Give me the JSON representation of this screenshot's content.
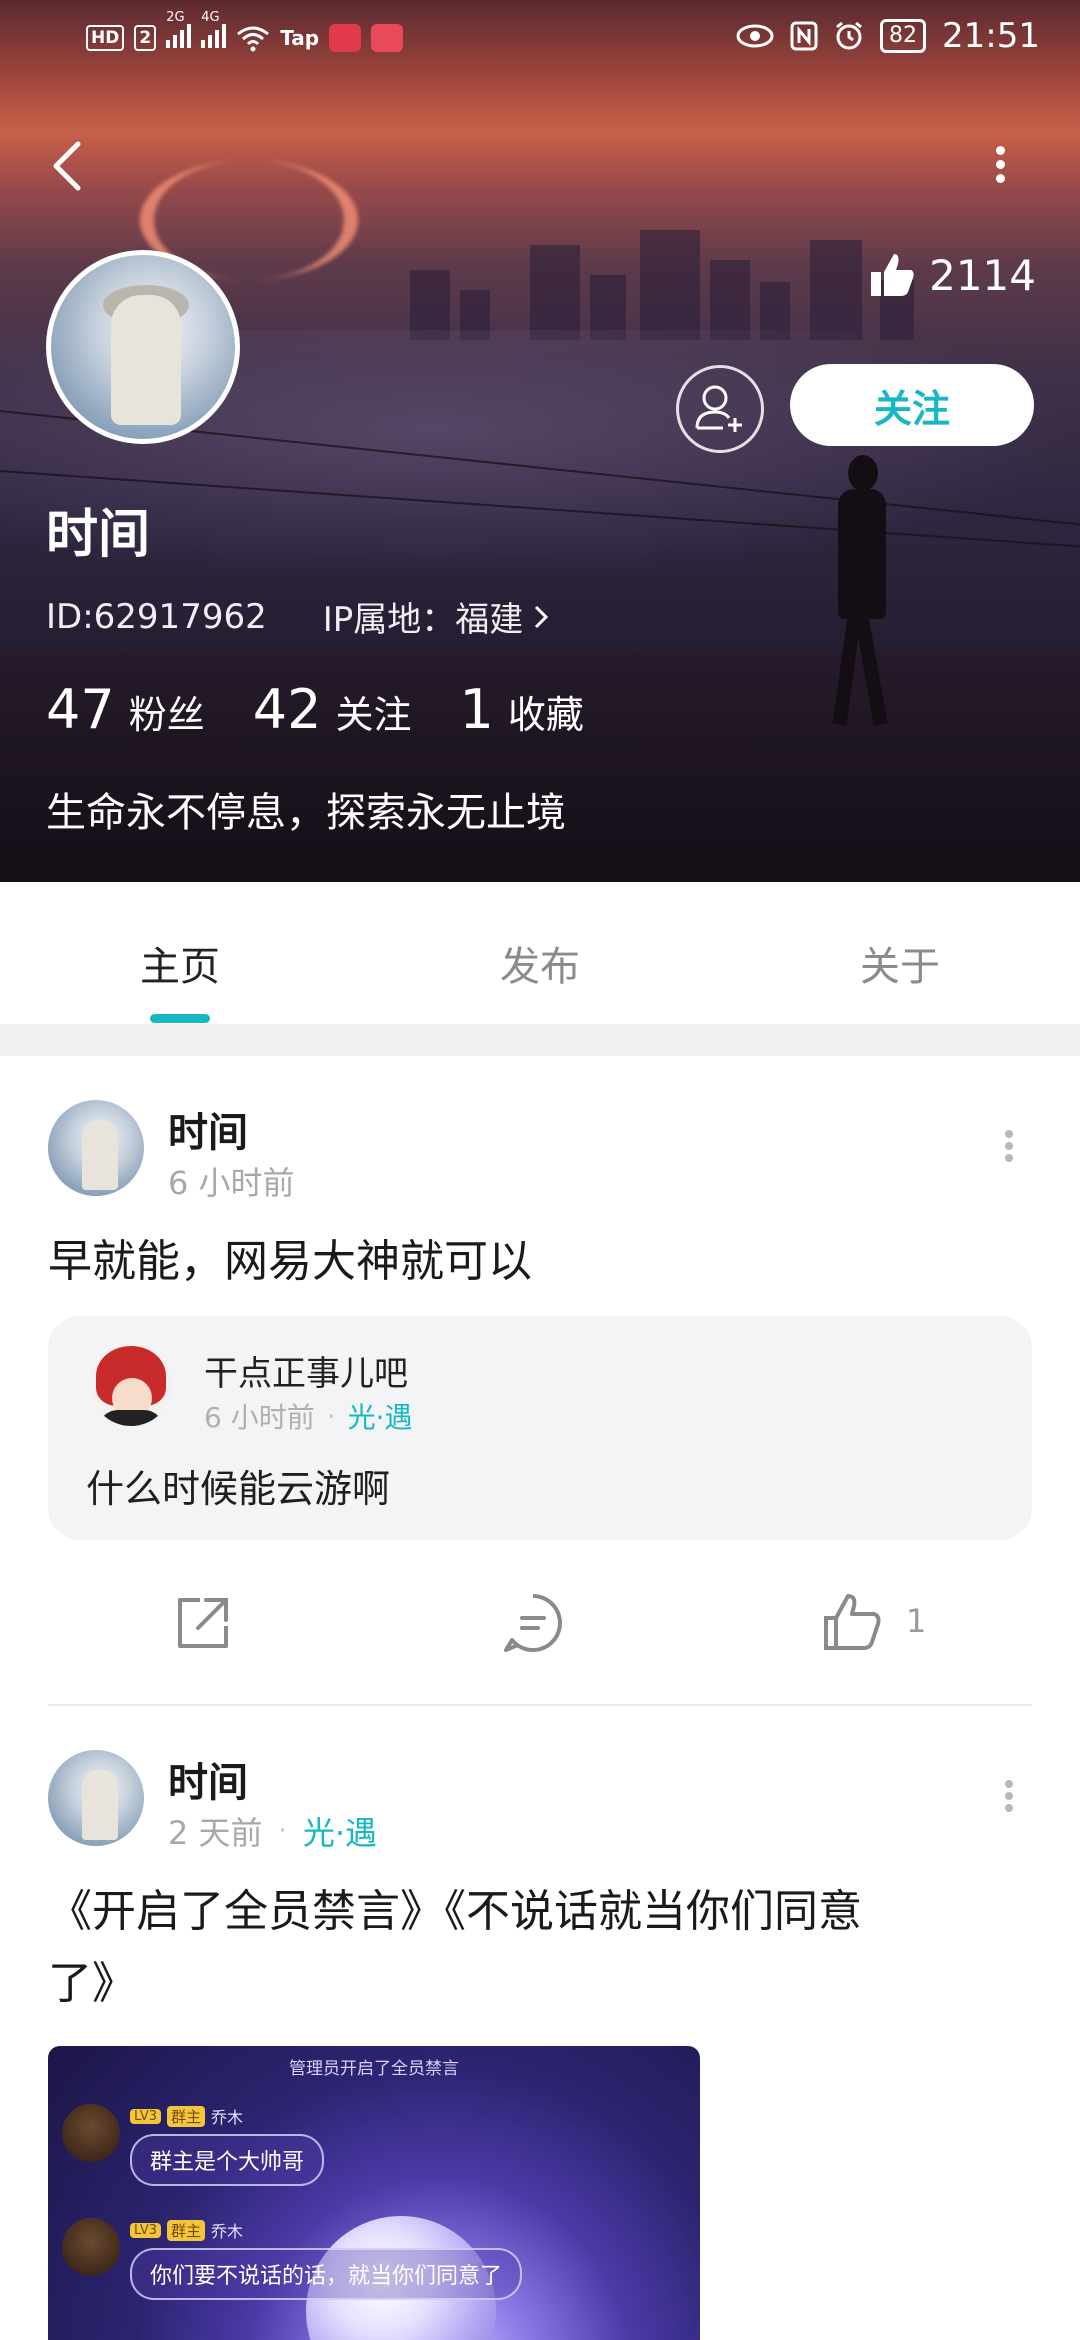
{
  "status_bar": {
    "left_icons": [
      "hd-icon",
      "signal-2g-icon",
      "signal-4g-icon",
      "wifi-icon",
      "tap-app-icon",
      "huawei-app-icon",
      "book-app-icon"
    ],
    "hd": "HD",
    "sim": "2",
    "net1": "2G",
    "net2": "4G",
    "tap": "Tap",
    "battery": "82",
    "time": "21:51"
  },
  "profile": {
    "username": "时间",
    "likes": "2114",
    "follow_label": "关注",
    "id_label": "ID:62917962",
    "ip_label": "IP属地：福建",
    "stats": [
      {
        "count": "47",
        "label": "粉丝"
      },
      {
        "count": "42",
        "label": "关注"
      },
      {
        "count": "1",
        "label": "收藏"
      }
    ],
    "bio": "生命永不停息，探索永无止境"
  },
  "tabs": [
    {
      "label": "主页",
      "active": true
    },
    {
      "label": "发布",
      "active": false
    },
    {
      "label": "关于",
      "active": false
    }
  ],
  "posts": [
    {
      "author": "时间",
      "time": "6 小时前",
      "text": "早就能，网易大神就可以",
      "quote": {
        "author": "干点正事儿吧",
        "time": "6 小时前",
        "tag": "光·遇",
        "text": "什么时候能云游啊"
      },
      "like_count": "1"
    },
    {
      "author": "时间",
      "time": "2 天前",
      "tag": "光·遇",
      "text_line1": "《开启了全员禁言》《不说话就当你们同意",
      "text_line2": "了》",
      "image": {
        "caption": "管理员开启了全员禁言",
        "messages": [
          {
            "level": "LV3",
            "role": "群主",
            "name": "乔木",
            "text": "群主是个大帅哥"
          },
          {
            "level": "LV3",
            "role": "群主",
            "name": "乔木",
            "text": "你们要不说话的话，就当你们同意了"
          }
        ]
      }
    }
  ],
  "colors": {
    "accent": "#17b8c4",
    "banner_top": "#a0463d",
    "banner_bottom": "#1b1522"
  }
}
